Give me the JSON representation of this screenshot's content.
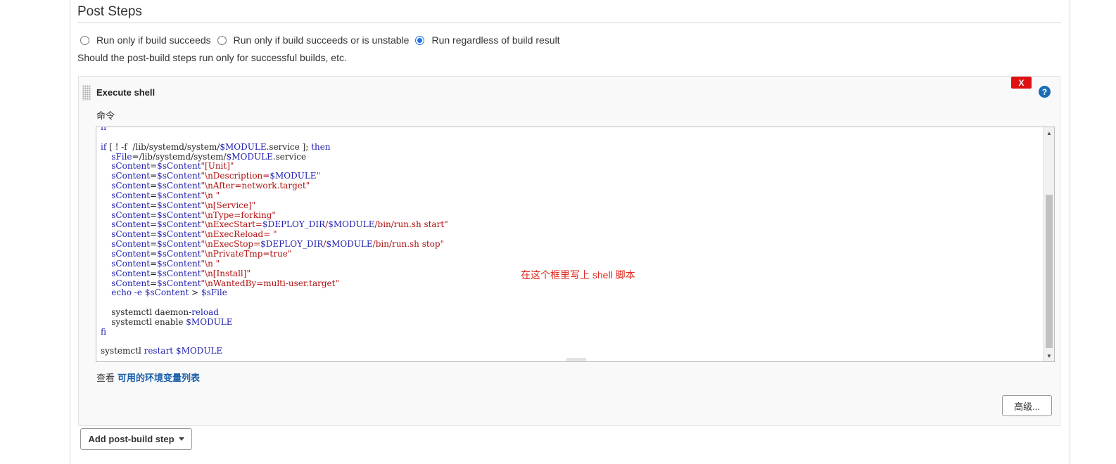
{
  "section": {
    "title": "Post Steps",
    "radios": [
      {
        "label": "Run only if build succeeds",
        "checked": false
      },
      {
        "label": "Run only if build succeeds or is unstable",
        "checked": false
      },
      {
        "label": "Run regardless of build result",
        "checked": true
      }
    ],
    "help_text": "Should the post-build steps run only for successful builds, etc."
  },
  "step": {
    "title": "Execute shell",
    "delete_label": "X",
    "help_label": "?",
    "command_label": "命令",
    "annotation": "在这个框里写上 shell 脚本",
    "env_prefix": "查看",
    "env_link": "可用的环境变量列表",
    "advanced_label": "高级...",
    "code_lines": [
      "fi",
      "",
      "if [ ! -f  /lib/systemd/system/$MODULE.service ]; then",
      "    sFile=/lib/systemd/system/$MODULE.service",
      "    sContent=$sContent\"[Unit]\"",
      "    sContent=$sContent\"\\nDescription=$MODULE\"",
      "    sContent=$sContent\"\\nAfter=network.target\"",
      "    sContent=$sContent\"\\n \"",
      "    sContent=$sContent\"\\n[Service]\"",
      "    sContent=$sContent\"\\nType=forking\"",
      "    sContent=$sContent\"\\nExecStart=$DEPLOY_DIR/$MODULE/bin/run.sh start\"",
      "    sContent=$sContent\"\\nExecReload= \"",
      "    sContent=$sContent\"\\nExecStop=$DEPLOY_DIR/$MODULE/bin/run.sh stop\"",
      "    sContent=$sContent\"\\nPrivateTmp=true\"",
      "    sContent=$sContent\"\\n \"",
      "    sContent=$sContent\"\\n[Install]\"",
      "    sContent=$sContent\"\\nWantedBy=multi-user.target\"",
      "    echo -e $sContent > $sFile",
      "",
      "    systemctl daemon-reload",
      "    systemctl enable $MODULE",
      "fi",
      "",
      "systemctl restart $MODULE"
    ]
  },
  "add_step": {
    "label": "Add post-build step"
  },
  "colors": {
    "keyword": "#1f1fb0",
    "string": "#b01010",
    "annotation": "#e0281c",
    "delete": "#dd1111",
    "help": "#1a6db4",
    "link": "#1a5ea8"
  }
}
